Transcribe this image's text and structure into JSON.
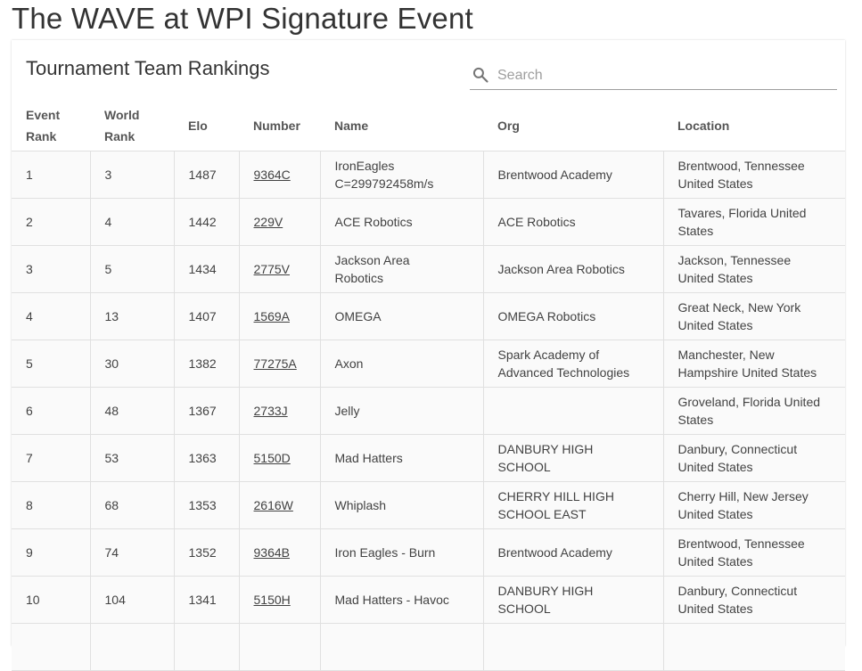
{
  "page": {
    "title": "The WAVE at WPI Signature Event"
  },
  "card": {
    "title": "Tournament Team Rankings",
    "search": {
      "placeholder": "Search",
      "value": ""
    }
  },
  "table": {
    "headers": {
      "event_rank": [
        "Event",
        "Rank"
      ],
      "world_rank": [
        "World",
        "Rank"
      ],
      "elo": "Elo",
      "number": "Number",
      "name": "Name",
      "org": "Org",
      "location": "Location"
    },
    "rows": [
      {
        "event_rank": "1",
        "world_rank": "3",
        "elo": "1487",
        "number": "9364C",
        "name": [
          "IronEagles",
          "C=299792458m/s"
        ],
        "org": [
          "Brentwood Academy"
        ],
        "location": [
          "Brentwood, Tennessee",
          "United States"
        ]
      },
      {
        "event_rank": "2",
        "world_rank": "4",
        "elo": "1442",
        "number": "229V",
        "name": [
          "ACE Robotics"
        ],
        "org": [
          "ACE Robotics"
        ],
        "location": [
          "Tavares, Florida United",
          "States"
        ]
      },
      {
        "event_rank": "3",
        "world_rank": "5",
        "elo": "1434",
        "number": "2775V",
        "name": [
          "Jackson Area",
          "Robotics"
        ],
        "org": [
          "Jackson Area Robotics"
        ],
        "location": [
          "Jackson, Tennessee",
          "United States"
        ]
      },
      {
        "event_rank": "4",
        "world_rank": "13",
        "elo": "1407",
        "number": "1569A",
        "name": [
          "OMEGA"
        ],
        "org": [
          "OMEGA Robotics"
        ],
        "location": [
          "Great Neck, New York",
          "United States"
        ]
      },
      {
        "event_rank": "5",
        "world_rank": "30",
        "elo": "1382",
        "number": "77275A",
        "name": [
          "Axon"
        ],
        "org": [
          "Spark Academy of",
          "Advanced Technologies"
        ],
        "location": [
          "Manchester, New",
          "Hampshire United States"
        ]
      },
      {
        "event_rank": "6",
        "world_rank": "48",
        "elo": "1367",
        "number": "2733J",
        "name": [
          "Jelly"
        ],
        "org": [],
        "location": [
          "Groveland, Florida United",
          "States"
        ]
      },
      {
        "event_rank": "7",
        "world_rank": "53",
        "elo": "1363",
        "number": "5150D",
        "name": [
          "Mad Hatters"
        ],
        "org": [
          "DANBURY HIGH SCHOOL"
        ],
        "location": [
          "Danbury, Connecticut",
          "United States"
        ]
      },
      {
        "event_rank": "8",
        "world_rank": "68",
        "elo": "1353",
        "number": "2616W",
        "name": [
          "Whiplash"
        ],
        "org": [
          "CHERRY HILL HIGH",
          "SCHOOL EAST"
        ],
        "location": [
          "Cherry Hill, New Jersey",
          "United States"
        ]
      },
      {
        "event_rank": "9",
        "world_rank": "74",
        "elo": "1352",
        "number": "9364B",
        "name": [
          "Iron Eagles - Burn"
        ],
        "org": [
          "Brentwood Academy"
        ],
        "location": [
          "Brentwood, Tennessee",
          "United States"
        ]
      },
      {
        "event_rank": "10",
        "world_rank": "104",
        "elo": "1341",
        "number": "5150H",
        "name": [
          "Mad Hatters - Havoc"
        ],
        "org": [
          "DANBURY HIGH SCHOOL"
        ],
        "location": [
          "Danbury, Connecticut",
          "United States"
        ]
      },
      {
        "event_rank": "",
        "world_rank": "",
        "elo": "",
        "number": "",
        "name": [],
        "org": [],
        "location": []
      }
    ]
  },
  "colors": {
    "text": "#424242",
    "border": "#e0e0e0",
    "row_bg": "#fafafa",
    "placeholder": "#9e9e9e"
  }
}
